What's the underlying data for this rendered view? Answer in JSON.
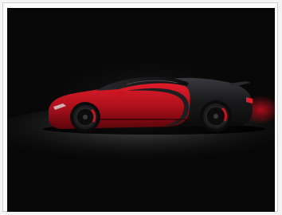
{
  "image": {
    "subject": "car-photo",
    "colors": {
      "background": "#070707",
      "body_red": "#b0101c",
      "body_dark": "#1a1a1c",
      "floor_light": "#9a9a9a"
    }
  }
}
